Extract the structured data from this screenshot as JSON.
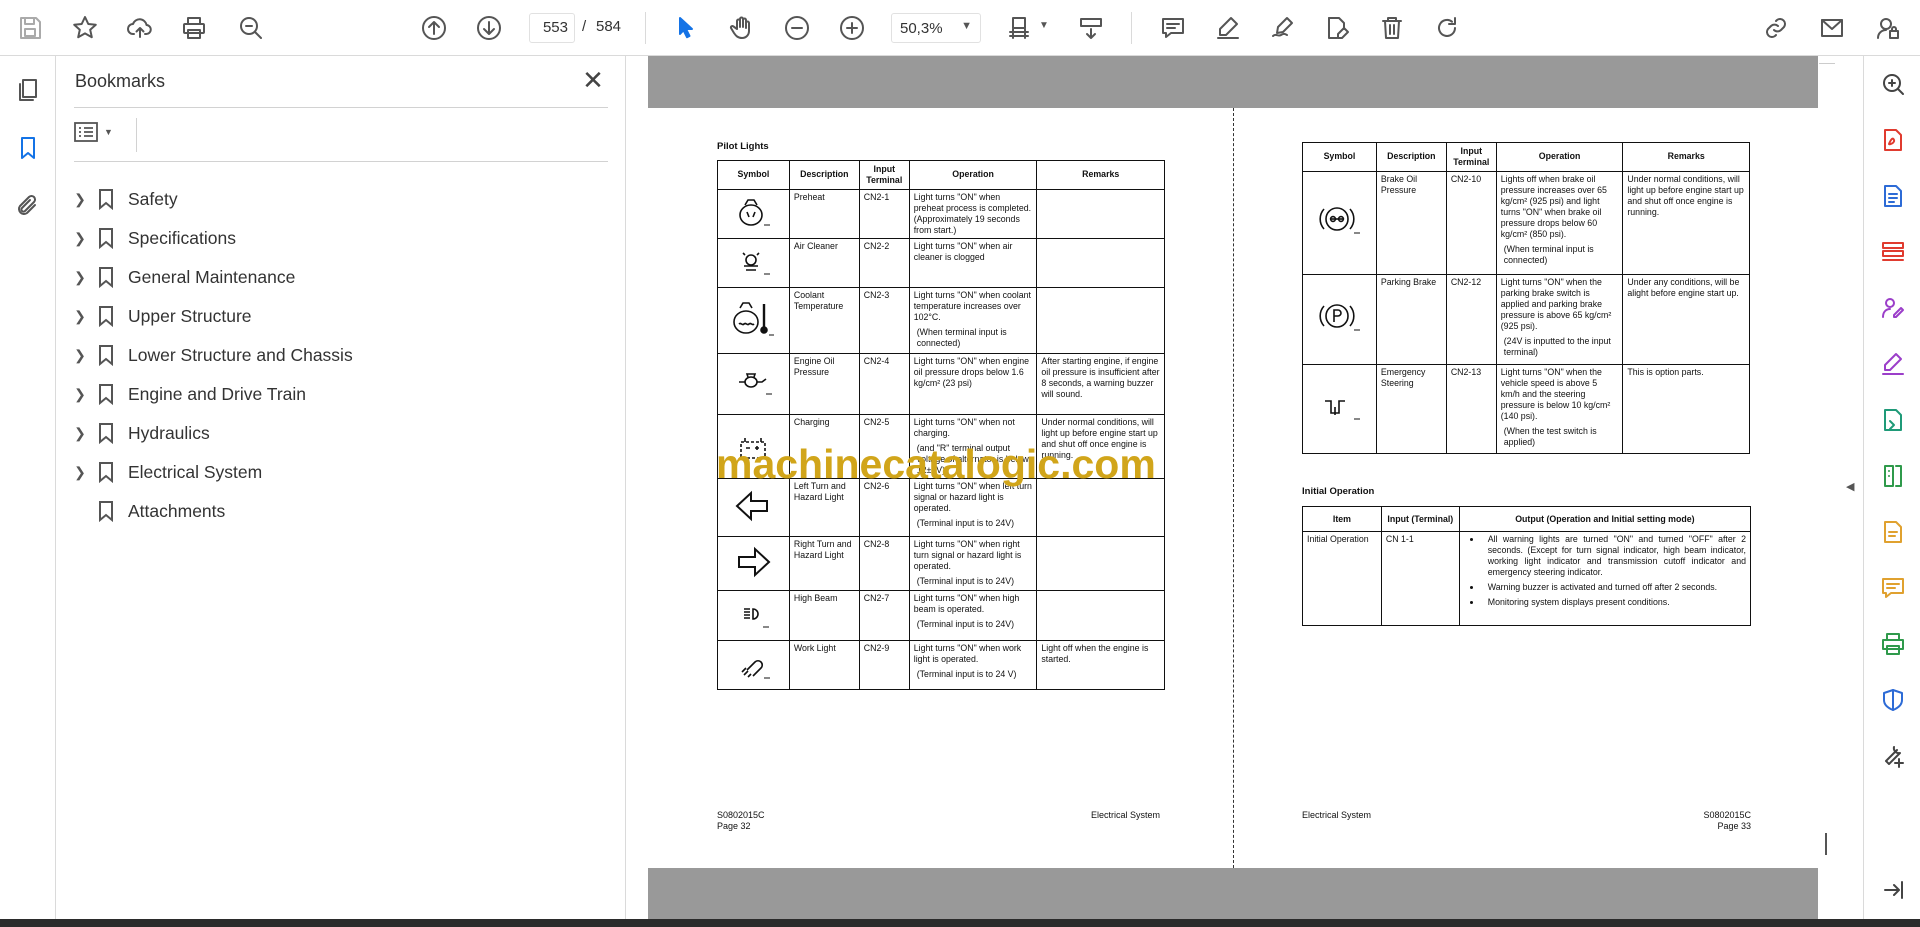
{
  "toolbar": {
    "left_tools": [
      "save-icon",
      "star-icon",
      "upload-icon",
      "print-icon",
      "zoom-search-icon"
    ],
    "page_current": "553",
    "page_separator": "/",
    "page_total": "584",
    "zoom_value": "50,3%"
  },
  "bookmarks": {
    "title": "Bookmarks",
    "items": [
      {
        "label": "Safety",
        "expandable": true
      },
      {
        "label": "Specifications",
        "expandable": true
      },
      {
        "label": "General Maintenance",
        "expandable": true
      },
      {
        "label": "Upper Structure",
        "expandable": true
      },
      {
        "label": "Lower Structure and Chassis",
        "expandable": true
      },
      {
        "label": "Engine and Drive Train",
        "expandable": true
      },
      {
        "label": "Hydraulics",
        "expandable": true
      },
      {
        "label": "Electrical System",
        "expandable": true
      },
      {
        "label": "Attachments",
        "expandable": false
      }
    ]
  },
  "left_page": {
    "title": "Pilot Lights",
    "headers": [
      "Symbol",
      "Description",
      "Input Terminal",
      "Operation",
      "Remarks"
    ],
    "rows": [
      {
        "desc": "Preheat",
        "term": "CN2-1",
        "op": "Light turns \"ON\" when preheat process is completed. (Approximately 19 seconds from start.)",
        "note": "",
        "rem": ""
      },
      {
        "desc": "Air Cleaner",
        "term": "CN2-2",
        "op": "Light turns \"ON\" when air cleaner is clogged",
        "note": "",
        "rem": ""
      },
      {
        "desc": "Coolant Temperature",
        "term": "CN2-3",
        "op": "Light turns \"ON\" when coolant temperature increases over 102°C.",
        "note": "(When terminal input is connected)",
        "rem": ""
      },
      {
        "desc": "Engine Oil Pressure",
        "term": "CN2-4",
        "op": "Light turns \"ON\" when engine oil pressure drops below 1.6 kg/cm² (23 psi)",
        "note": "",
        "rem": "After starting engine, if engine oil pressure is insufficient after 8 seconds, a warning buzzer will sound."
      },
      {
        "desc": "Charging",
        "term": "CN2-5",
        "op": "Light turns \"ON\" when not charging.",
        "note": "(and \"R\" terminal output voltage of alternator is below 12±1V)",
        "rem": "Under normal conditions, will light up before engine start up and shut off once engine is running."
      },
      {
        "desc": "Left Turn and Hazard Light",
        "term": "CN2-6",
        "op": "Light turns \"ON\" when left turn signal or hazard light is operated.",
        "note": "(Terminal input is to 24V)",
        "rem": ""
      },
      {
        "desc": "Right Turn and Hazard Light",
        "term": "CN2-8",
        "op": "Light turns \"ON\" when right turn signal or hazard light is operated.",
        "note": "(Terminal input is to 24V)",
        "rem": ""
      },
      {
        "desc": "High Beam",
        "term": "CN2-7",
        "op": "Light turns \"ON\" when high beam is operated.",
        "note": "(Terminal input is to 24V)",
        "rem": ""
      },
      {
        "desc": "Work Light",
        "term": "CN2-9",
        "op": "Light turns \"ON\" when work light is operated.",
        "note": "(Terminal input is to 24 V)",
        "rem": "Light off when the engine is started."
      }
    ],
    "footer_code": "S0802015C",
    "footer_page": "Page 32",
    "footer_section": "Electrical System"
  },
  "right_page": {
    "headers": [
      "Symbol",
      "Description",
      "Input Terminal",
      "Operation",
      "Remarks"
    ],
    "rows": [
      {
        "desc": "Brake Oil Pressure",
        "term": "CN2-10",
        "op": "Lights off when brake oil pressure increases over 65 kg/cm² (925 psi) and light turns \"ON\" when brake oil pressure drops below 60 kg/cm² (850 psi).",
        "note": "(When terminal input is connected)",
        "rem": "Under normal conditions, will light up before engine start up and shut off once engine is running."
      },
      {
        "desc": "Parking Brake",
        "term": "CN2-12",
        "op": "Light turns \"ON\" when the parking brake switch is applied and parking brake pressure is above 65 kg/cm² (925 psi).",
        "note": "(24V is inputted to the input terminal)",
        "rem": "Under any conditions, will be alight before engine start up."
      },
      {
        "desc": "Emergency Steering",
        "term": "CN2-13",
        "op": "Light turns \"ON\" when the vehicle speed is above 5 km/h and the steering pressure is below 10 kg/cm² (140 psi).",
        "note": "(When the test switch is applied)",
        "rem": "This is option parts."
      }
    ],
    "init_title": "Initial Operation",
    "init_headers": [
      "Item",
      "Input (Terminal)",
      "Output (Operation and Initial setting mode)"
    ],
    "init_item": "Initial Operation",
    "init_term": "CN 1-1",
    "init_bullets": [
      "All warning lights are turned \"ON\" and turned \"OFF\" after 2 seconds. (Except for turn signal indicator, high beam indicator, working light indicator and transmission cutoff indicator and emergency steering indicator.",
      "Warning buzzer is activated and turned off after 2 seconds.",
      "Monitoring system displays present conditions."
    ],
    "footer_section": "Electrical System",
    "footer_code": "S0802015C",
    "footer_page": "Page 33"
  },
  "watermark": "machinecatalogic.com",
  "colors": {
    "accent": "#1473e6",
    "watermark": "#d1a51a",
    "gutter": "#999999"
  }
}
